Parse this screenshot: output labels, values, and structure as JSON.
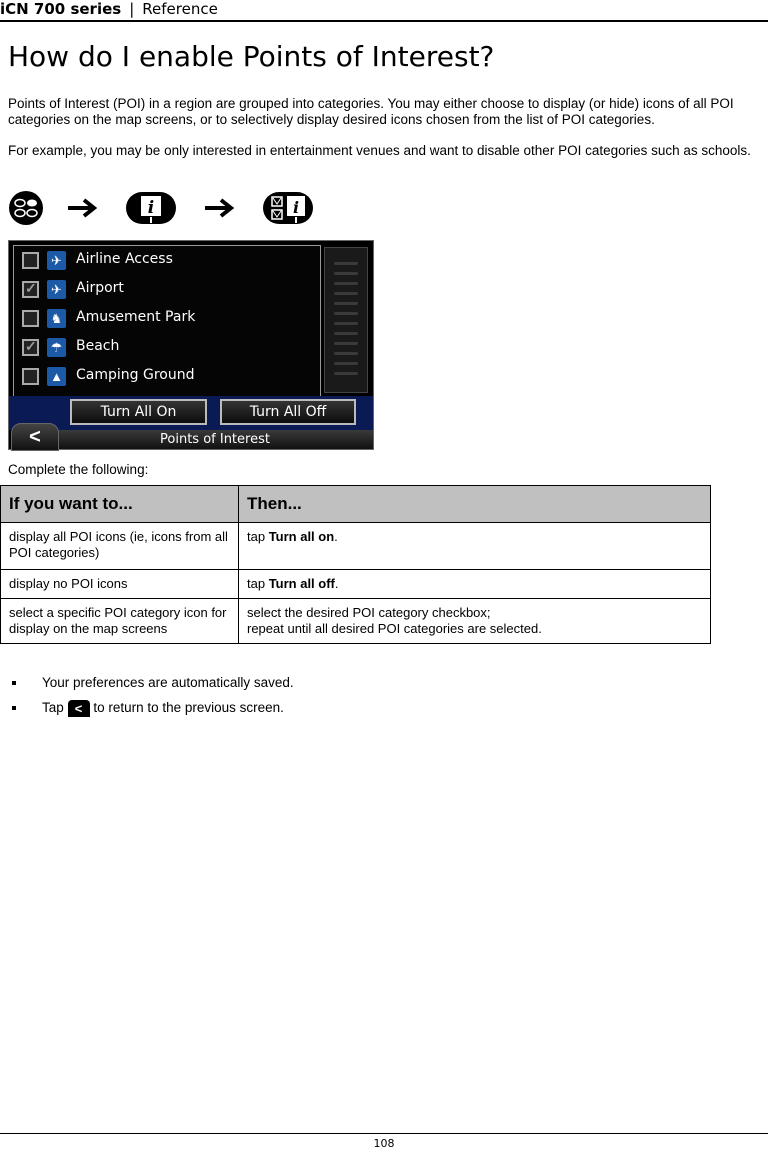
{
  "header": {
    "product": "iCN 700 series",
    "separator": "|",
    "section": "Reference"
  },
  "title": "How do I enable Points of Interest?",
  "intro": "Points of Interest (POI) in a region are grouped into categories. You may either choose to display (or hide) icons of all POI categories on the map screens, or to selectively display desired icons chosen from the list of POI categories.",
  "example": "For example, you may be only interested in entertainment venues and want to disable other POI categories such as schools.",
  "nav_icons": [
    "main-menu-icon",
    "arrow-right-icon",
    "poi-info-icon",
    "arrow-right-icon",
    "poi-checklist-icon"
  ],
  "screen": {
    "items": [
      {
        "label": "Airline Access",
        "checked": false,
        "icon": "airline-access-icon",
        "glyph": "✈"
      },
      {
        "label": "Airport",
        "checked": true,
        "icon": "airport-icon",
        "glyph": "✈"
      },
      {
        "label": "Amusement Park",
        "checked": false,
        "icon": "amusement-park-icon",
        "glyph": "♞"
      },
      {
        "label": "Beach",
        "checked": true,
        "icon": "beach-icon",
        "glyph": "☂"
      },
      {
        "label": "Camping Ground",
        "checked": false,
        "icon": "camping-ground-icon",
        "glyph": "▲"
      }
    ],
    "turn_all_on": "Turn All On",
    "turn_all_off": "Turn All Off",
    "title": "Points of Interest",
    "back_glyph": "<"
  },
  "complete_label": "Complete the following:",
  "table": {
    "headers": [
      "If you want to...",
      "Then..."
    ],
    "rows": [
      {
        "want": "display all POI icons (ie, icons from all POI categories)",
        "then_pre": "tap ",
        "then_bold": "Turn all on",
        "then_post": "."
      },
      {
        "want": "display no POI icons",
        "then_pre": "tap ",
        "then_bold": "Turn all off",
        "then_post": "."
      },
      {
        "want": "select a specific POI category icon for display on the map screens",
        "then_line1": "select the desired POI category checkbox;",
        "then_line2": "repeat until all desired POI categories are selected."
      }
    ]
  },
  "bullets": {
    "b1": "Your preferences are automatically saved.",
    "b2_pre": "Tap",
    "b2_post": "to return to the previous screen."
  },
  "page_number": "108"
}
